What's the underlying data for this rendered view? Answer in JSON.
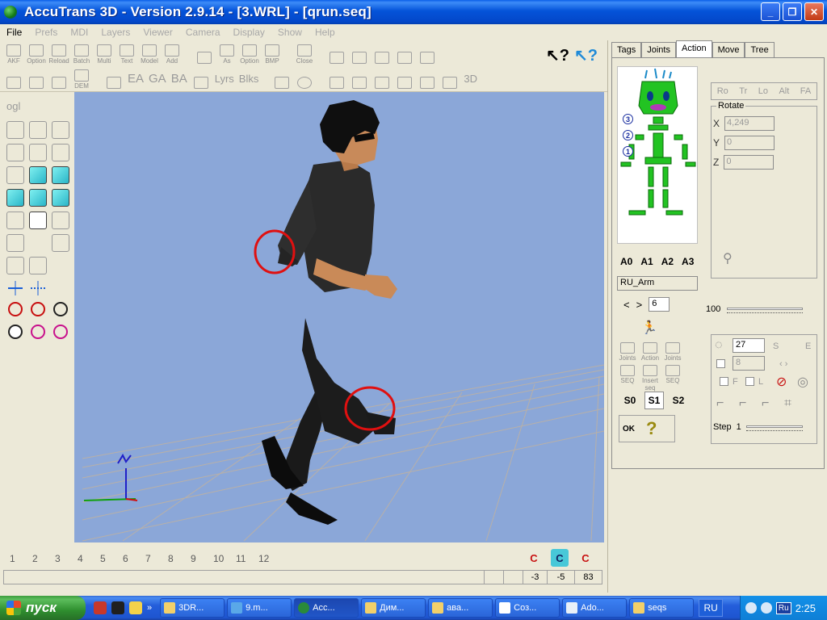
{
  "window": {
    "title": "AccuTrans 3D - Version 2.9.14 - [3.WRL] - [qrun.seq]",
    "buttons": [
      "_",
      "❐",
      "✕"
    ]
  },
  "menu": [
    "File",
    "Prefs",
    "MDI",
    "Layers",
    "Viewer",
    "Camera",
    "Display",
    "Show",
    "Help"
  ],
  "toolbar": {
    "row1_labels": [
      "AKF",
      "Option",
      "Reload",
      "Batch",
      "Multi",
      "Text",
      "Model",
      "Add",
      "",
      "As",
      "Option",
      "BMP",
      "",
      "Close"
    ],
    "row2_text": [
      "EA",
      "GA",
      "BA",
      "Lyrs",
      "Blks",
      "3D"
    ],
    "dem_label": "DEM"
  },
  "left_tools": {
    "ogl_label": "ogl"
  },
  "timeline": {
    "frames": [
      "1",
      "2",
      "3",
      "4",
      "5",
      "6",
      "7",
      "8",
      "9",
      "10",
      "11",
      "12"
    ]
  },
  "status": {
    "values": [
      "-3",
      "-5",
      "83"
    ]
  },
  "camera_icons": [
    "C",
    "C",
    "C"
  ],
  "right_panel": {
    "tabs": [
      "Tags",
      "Joints",
      "Action",
      "Move",
      "Tree"
    ],
    "active_tab": "Action",
    "skeleton_numbers": [
      "3",
      "2",
      "1"
    ],
    "action_slots": [
      "A0",
      "A1",
      "A2",
      "A3"
    ],
    "joint_name": "RU_Arm",
    "nav_prev": "<",
    "nav_next": ">",
    "nav_value": "6",
    "small_buttons": [
      "Joints",
      "Action",
      "Joints",
      "SEQ",
      "Insert seq",
      "SEQ"
    ],
    "seq_slots": [
      "S0",
      "S1",
      "S2"
    ],
    "active_seq": "S1",
    "ok_label": "OK",
    "help_label": "?",
    "rot_tabs": [
      "Ro",
      "Tr",
      "Lo",
      "Alt",
      "FA"
    ],
    "rotate_title": "Rotate",
    "rotate": [
      {
        "axis": "X",
        "value": "4,249"
      },
      {
        "axis": "Y",
        "value": "0"
      },
      {
        "axis": "Z",
        "value": "0"
      }
    ],
    "slider_value": "100",
    "lower": {
      "count": "27",
      "sub_value": "8",
      "s_label": "S",
      "e_label": "E",
      "f_label": "F",
      "l_label": "L",
      "step_label": "Step",
      "step_value": "1"
    }
  },
  "taskbar": {
    "start": "пуск",
    "tasks": [
      "3DR...",
      "9.m...",
      "Acc...",
      "Дим...",
      "ава...",
      "Соз...",
      "Ado...",
      "seqs"
    ],
    "active_task": "Acc...",
    "lang": "RU",
    "tray_lang": "Ru",
    "clock": "2:25"
  }
}
